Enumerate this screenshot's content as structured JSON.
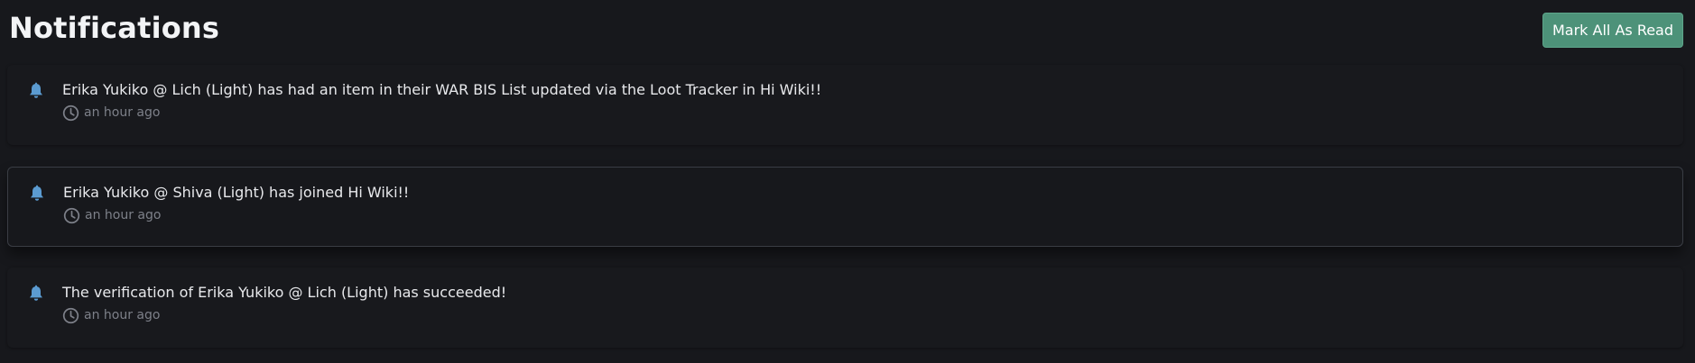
{
  "header": {
    "title": "Notifications",
    "mark_all_label": "Mark All As Read"
  },
  "notifications": [
    {
      "message": "Erika Yukiko @ Lich (Light) has had an item in their WAR BIS List updated via the Loot Tracker in Hi Wiki!!",
      "time": "an hour ago",
      "icon": "bell-icon"
    },
    {
      "message": "Erika Yukiko @ Shiva (Light) has joined Hi Wiki!!",
      "time": "an hour ago",
      "icon": "bell-icon"
    },
    {
      "message": "The verification of Erika Yukiko @ Lich (Light) has succeeded!",
      "time": "an hour ago",
      "icon": "bell-icon"
    }
  ],
  "colors": {
    "background": "#17181c",
    "accent_button": "#4d9279",
    "bell": "#5b9bd1",
    "muted_text": "#7d8089"
  }
}
